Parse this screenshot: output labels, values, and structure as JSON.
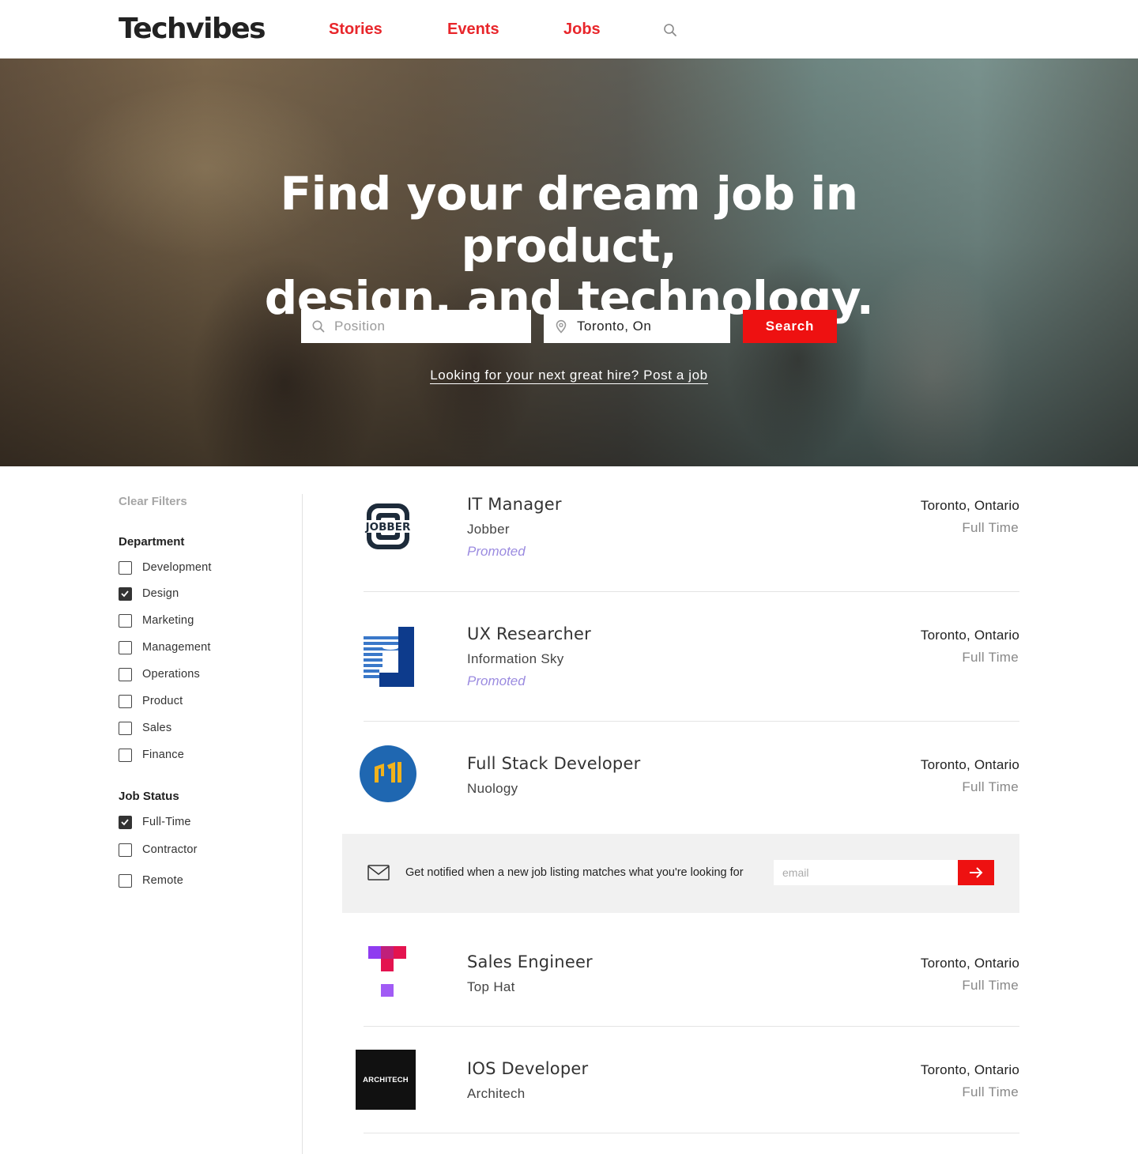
{
  "header": {
    "logo": "Techvibes",
    "nav": [
      {
        "label": "Stories"
      },
      {
        "label": "Events"
      },
      {
        "label": "Jobs"
      }
    ],
    "search_icon": "search-icon"
  },
  "hero": {
    "title_line1": "Find your dream job in product,",
    "title_line2": "design, and technology.",
    "position_placeholder": "Position",
    "location_value": "Toronto, On",
    "search_label": "Search",
    "post_link": "Looking for your next great hire? Post a job"
  },
  "filters": {
    "clear_label": "Clear Filters",
    "department": {
      "heading": "Department",
      "items": [
        {
          "label": "Development",
          "checked": false
        },
        {
          "label": "Design",
          "checked": true
        },
        {
          "label": "Marketing",
          "checked": false
        },
        {
          "label": "Management",
          "checked": false
        },
        {
          "label": "Operations",
          "checked": false
        },
        {
          "label": "Product",
          "checked": false
        },
        {
          "label": "Sales",
          "checked": false
        },
        {
          "label": "Finance",
          "checked": false
        }
      ]
    },
    "job_status": {
      "heading": "Job Status",
      "items": [
        {
          "label": "Full-Time",
          "checked": true
        },
        {
          "label": "Contractor",
          "checked": false
        },
        {
          "label": "Remote",
          "checked": false
        }
      ]
    }
  },
  "jobs": [
    {
      "title": "IT Manager",
      "company": "Jobber",
      "promoted": "Promoted",
      "location": "Toronto, Ontario",
      "type": "Full Time",
      "logo_text": "JOBBER"
    },
    {
      "title": "UX Researcher",
      "company": "Information Sky",
      "promoted": "Promoted",
      "location": "Toronto, Ontario",
      "type": "Full Time"
    },
    {
      "title": "Full Stack Developer",
      "company": "Nuology",
      "location": "Toronto, Ontario",
      "type": "Full Time"
    },
    {
      "title": "Sales Engineer",
      "company": "Top Hat",
      "location": "Toronto, Ontario",
      "type": "Full Time"
    },
    {
      "title": "IOS Developer",
      "company": "Architech",
      "location": "Toronto, Ontario",
      "type": "Full Time",
      "logo_text": "ARCHITECH"
    }
  ],
  "notify": {
    "text": "Get notified when a new job listing matches what you're looking for",
    "email_placeholder": "email"
  },
  "colors": {
    "accent_red": "#ee1111",
    "nav_red": "#e8262b",
    "promoted_purple": "#9b8be0"
  }
}
